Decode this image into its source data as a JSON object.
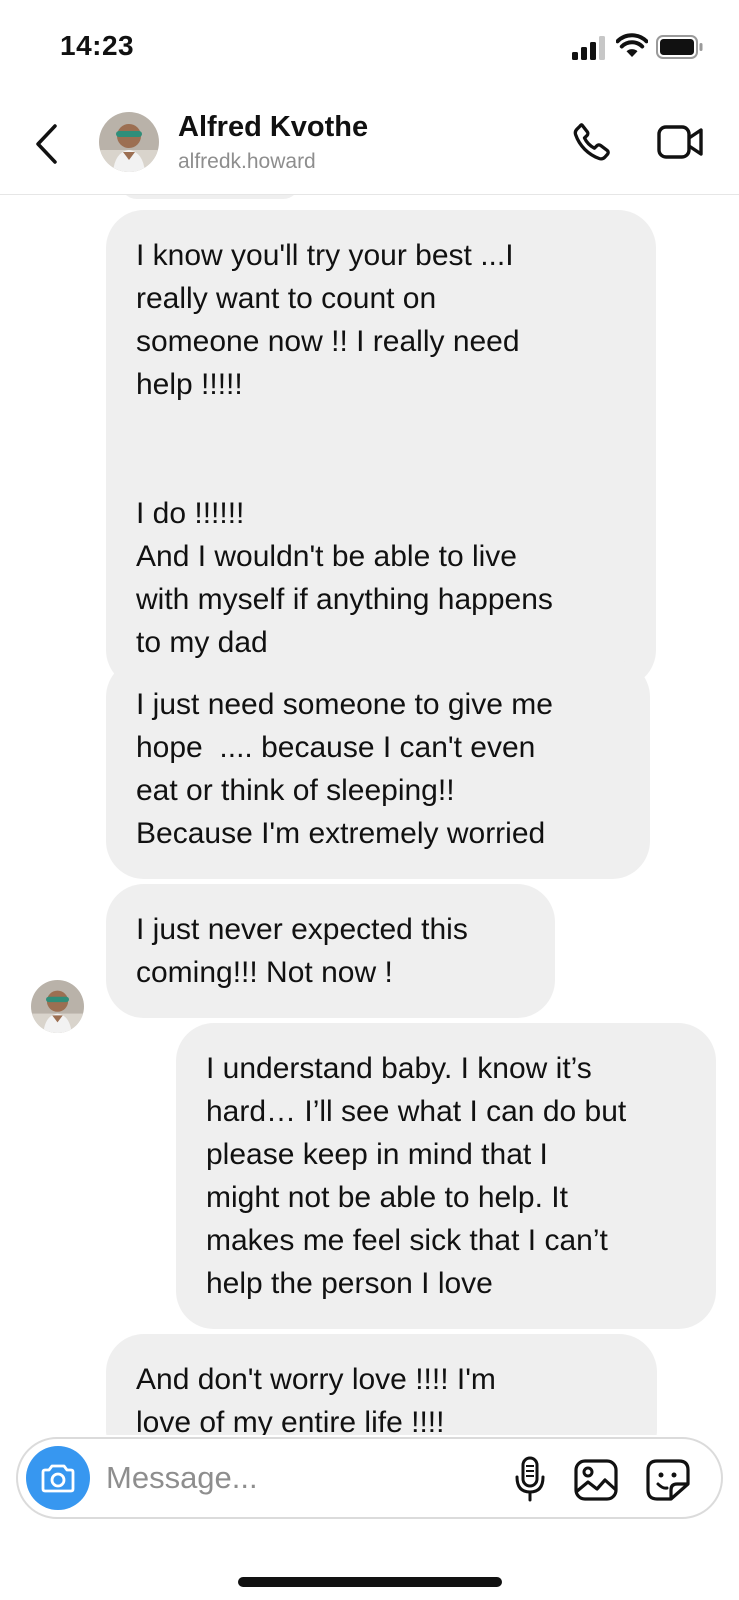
{
  "status_bar": {
    "time": "14:23",
    "icons": [
      "signal-icon",
      "wifi-icon",
      "battery-icon"
    ]
  },
  "header": {
    "name": "Alfred Kvothe",
    "handle": "alfredk.howard",
    "icons": [
      "back-chevron-icon",
      "phone-icon",
      "video-camera-icon"
    ]
  },
  "messages": [
    {
      "sender": "contact",
      "text": "I know you'll try your best ...I\nreally want to count on\nsomeone now !! I really need\nhelp !!!!!\n\n\nI do !!!!!!\nAnd I wouldn't be able to live\nwith myself if anything happens\nto my dad"
    },
    {
      "sender": "contact",
      "text": "I just need someone to give me\nhope  .... because I can't even\neat or think of sleeping!!\nBecause I'm extremely worried"
    },
    {
      "sender": "contact",
      "text": "I just never expected this\ncoming!!! Not now !"
    },
    {
      "sender": "me",
      "text": "I understand baby. I know it’s\nhard… I’ll see what I can do but\nplease keep in mind that I\nmight not be able to help. It\nmakes me feel sick that I can’t\nhelp the person I love"
    },
    {
      "sender": "contact",
      "text": "And don't worry love !!!! I'm\nlove of my entire life !!!!"
    }
  ],
  "composer": {
    "placeholder": "Message...",
    "icons": [
      "camera-icon",
      "microphone-icon",
      "gallery-icon",
      "sticker-icon"
    ]
  },
  "colors": {
    "bubble": "#efefef",
    "accent": "#3797f0",
    "secondary_text": "#8e8e8e"
  }
}
